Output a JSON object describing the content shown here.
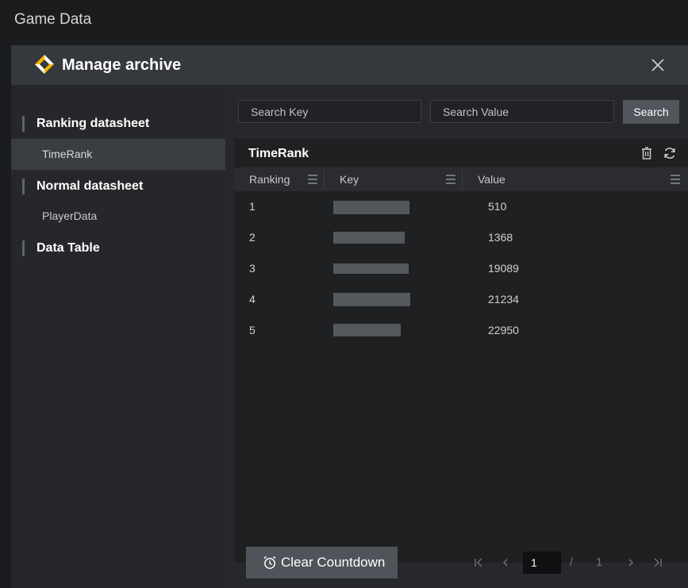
{
  "app": {
    "title": "Game Data"
  },
  "modal": {
    "title": "Manage archive"
  },
  "sidebar": {
    "sections": [
      {
        "title": "Ranking datasheet",
        "items": [
          "TimeRank"
        ]
      },
      {
        "title": "Normal datasheet",
        "items": [
          "PlayerData"
        ]
      },
      {
        "title": "Data Table",
        "items": []
      }
    ],
    "active_item": "TimeRank"
  },
  "search": {
    "key_placeholder": "Search Key",
    "value_placeholder": "Search Value",
    "button_label": "Search"
  },
  "table": {
    "title": "TimeRank",
    "columns": [
      "Ranking",
      "Key",
      "Value"
    ],
    "rows": [
      {
        "ranking": "1",
        "key": "",
        "value": "510"
      },
      {
        "ranking": "2",
        "key": "",
        "value": "1368"
      },
      {
        "ranking": "3",
        "key": "",
        "value": "19089"
      },
      {
        "ranking": "4",
        "key": "",
        "value": "21234"
      },
      {
        "ranking": "5",
        "key": "",
        "value": "22950"
      }
    ]
  },
  "footer": {
    "clear_button_label": "Clear Countdown",
    "pagination": {
      "current_page": "1",
      "separator": "/",
      "total_pages": "1"
    }
  },
  "colors": {
    "background": "#1b1c1e",
    "panel": "#27282b",
    "header": "#35383c",
    "button": "#51565c",
    "accent_logo": "#f5b400"
  }
}
